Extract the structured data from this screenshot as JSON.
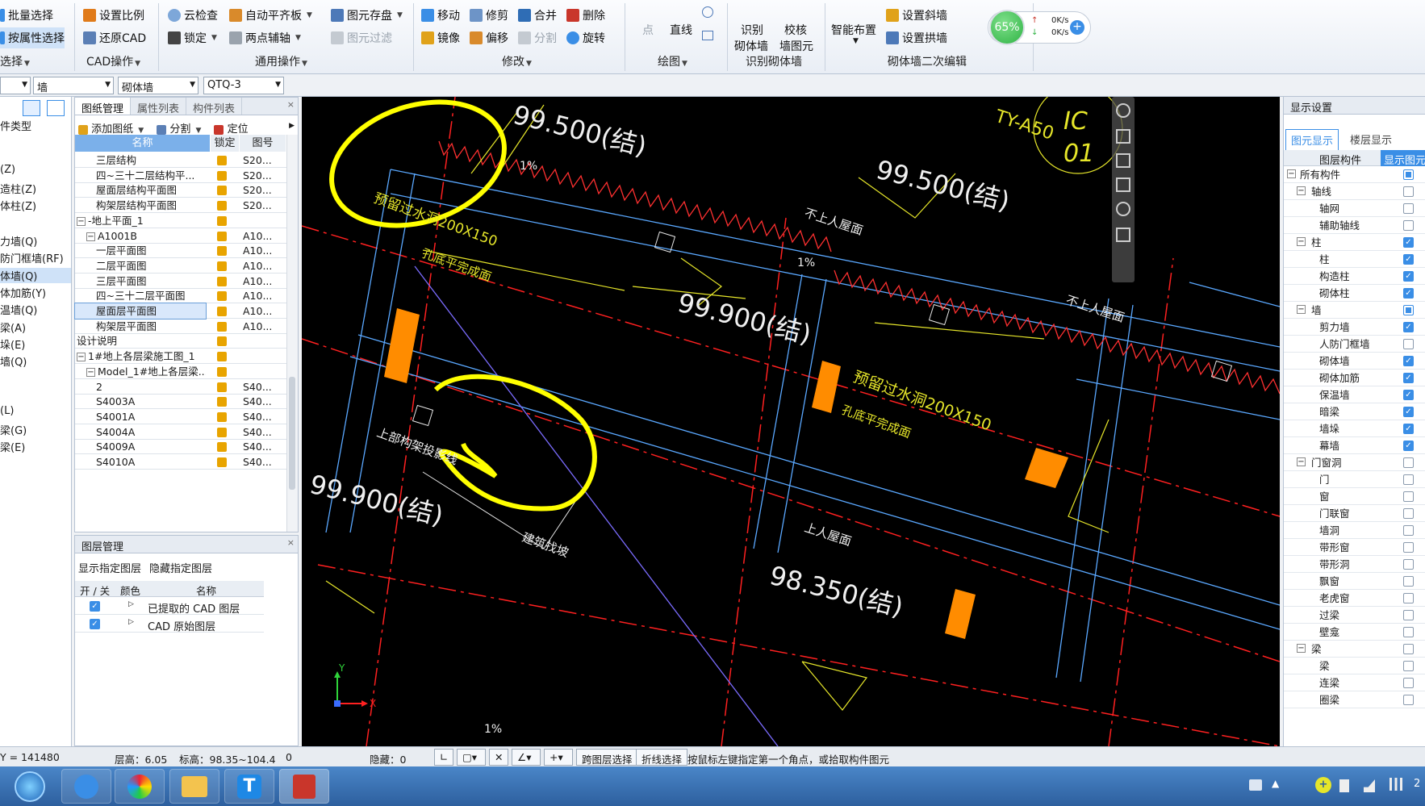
{
  "colors": {
    "accent": "#3a8ee6",
    "select_orange": "#ff8c00",
    "highlight": "#ffff00",
    "canvas_bg": "#000000",
    "green_badge": "#2fb344"
  },
  "ribbon": {
    "col0": {
      "btn1": "批量选择",
      "btn2": "按属性选择",
      "group": "选择"
    },
    "col1": {
      "btn1": "设置比例",
      "btn2": "还原CAD",
      "group": "CAD操作"
    },
    "col2": {
      "btn1": "云检查",
      "btn2": "自动平齐板",
      "btn3": "图元存盘",
      "btn4": "锁定",
      "btn5": "两点辅轴",
      "btn6": "图元过滤",
      "group": "通用操作"
    },
    "col3": {
      "btn1": "移动",
      "btn2": "修剪",
      "btn3": "合并",
      "btn4": "删除",
      "btn5": "镜像",
      "btn6": "偏移",
      "btn7": "分割",
      "btn8": "旋转",
      "group": "修改"
    },
    "col4": {
      "btn1": "点",
      "btn2": "直线",
      "group": "绘图"
    },
    "col5": {
      "btn1a": "识别",
      "btn1b": "砌体墙",
      "btn2a": "校核",
      "btn2b": "墙图元",
      "group": "识别砌体墙"
    },
    "col6": {
      "btn1": "智能布置",
      "btn2": "设置斜墙",
      "btn3": "设置拱墙",
      "group": "砌体墙二次编辑"
    },
    "net": {
      "percent": "65%",
      "up": "0K/s",
      "down": "0K/s"
    }
  },
  "toolbar2": {
    "combo1": "",
    "combo2": "墙",
    "combo3": "砌体墙",
    "combo4": "QTQ-3"
  },
  "leftcol": {
    "items": [
      "件类型",
      "(Z)",
      "造柱(Z)",
      "体柱(Z)",
      "力墙(Q)",
      "防门框墙(RF)",
      "体墙(Q)",
      "体加筋(Y)",
      "温墙(Q)",
      "梁(A)",
      "垛(E)",
      "墙(Q)",
      "(L)",
      "梁(G)",
      "梁(E)"
    ]
  },
  "drawpanel": {
    "tabs": [
      "图纸管理",
      "属性列表",
      "构件列表"
    ],
    "toolbar": {
      "add": "添加图纸",
      "split": "分割",
      "locate": "定位"
    },
    "headers": {
      "name": "名称",
      "lock": "锁定",
      "code": "图号"
    },
    "rows": [
      {
        "name": "三层结构",
        "code": "S20..."
      },
      {
        "name": "四~三十二层结构平...",
        "code": "S20..."
      },
      {
        "name": "屋面层结构平面图",
        "code": "S20..."
      },
      {
        "name": "构架层结构平面图",
        "code": "S20..."
      },
      {
        "name": "-地上平面_1",
        "code": ""
      },
      {
        "name": "A1001B",
        "code": "A10..."
      },
      {
        "name": "一层平面图",
        "code": "A10..."
      },
      {
        "name": "二层平面图",
        "code": "A10..."
      },
      {
        "name": "三层平面图",
        "code": "A10..."
      },
      {
        "name": "四~三十二层平面图",
        "code": "A10..."
      },
      {
        "name": "屋面层平面图",
        "code": "A10..."
      },
      {
        "name": "构架层平面图",
        "code": "A10..."
      },
      {
        "name": "设计说明",
        "code": ""
      },
      {
        "name": "1#地上各层梁施工图_1",
        "code": ""
      },
      {
        "name": "Model_1#地上各层梁...",
        "code": ""
      },
      {
        "name": "2",
        "code": "S40..."
      },
      {
        "name": "S4003A",
        "code": "S40..."
      },
      {
        "name": "S4001A",
        "code": "S40..."
      },
      {
        "name": "S4004A",
        "code": "S40..."
      },
      {
        "name": "S4009A",
        "code": "S40..."
      },
      {
        "name": "S4010A",
        "code": "S40..."
      }
    ]
  },
  "layerpanel": {
    "title": "图层管理",
    "show_btn": "显示指定图层",
    "hide_btn": "隐藏指定图层",
    "h_onoff": "开 / 关",
    "h_color": "颜色",
    "h_name": "名称",
    "rows": [
      "已提取的 CAD 图层",
      "CAD 原始图层"
    ]
  },
  "canvas": {
    "t1": "99.500(结)",
    "t2": "99.500(结)",
    "t3": "99.900(结)",
    "t4": "99.900(结)",
    "t5": "98.350(结)",
    "t6": "预留过水洞200X150",
    "t7": "孔底平完成面",
    "t8": "预留过水洞200X150",
    "t9": "孔底平完成面",
    "t10": "不上人屋面",
    "t11": "不上人屋面",
    "t12": "上人屋面",
    "t13": "上部构架投影线",
    "t14": "建筑找坡",
    "t15": "1%",
    "t16": "1%",
    "t17": "1%",
    "t18": "IC",
    "t19": "01",
    "t20": "TY-A50",
    "ax_x": "X",
    "ax_y": "Y"
  },
  "rightpanel": {
    "title": "显示设置",
    "tab1": "图元显示",
    "tab2": "楼层显示",
    "h1": "图层构件",
    "h2": "显示图元",
    "rows": [
      {
        "name": "所有构件",
        "lv": 0,
        "exp": true,
        "ck": "partial"
      },
      {
        "name": "轴线",
        "lv": 1,
        "exp": true,
        "ck": "off"
      },
      {
        "name": "轴网",
        "lv": 2,
        "exp": false,
        "ck": "off"
      },
      {
        "name": "辅助轴线",
        "lv": 2,
        "exp": false,
        "ck": "off"
      },
      {
        "name": "柱",
        "lv": 1,
        "exp": true,
        "ck": "on"
      },
      {
        "name": "柱",
        "lv": 2,
        "exp": false,
        "ck": "on"
      },
      {
        "name": "构造柱",
        "lv": 2,
        "exp": false,
        "ck": "on"
      },
      {
        "name": "砌体柱",
        "lv": 2,
        "exp": false,
        "ck": "on"
      },
      {
        "name": "墙",
        "lv": 1,
        "exp": true,
        "ck": "partial"
      },
      {
        "name": "剪力墙",
        "lv": 2,
        "exp": false,
        "ck": "on"
      },
      {
        "name": "人防门框墙",
        "lv": 2,
        "exp": false,
        "ck": "off"
      },
      {
        "name": "砌体墙",
        "lv": 2,
        "exp": false,
        "ck": "on"
      },
      {
        "name": "砌体加筋",
        "lv": 2,
        "exp": false,
        "ck": "on"
      },
      {
        "name": "保温墙",
        "lv": 2,
        "exp": false,
        "ck": "on"
      },
      {
        "name": "暗梁",
        "lv": 2,
        "exp": false,
        "ck": "on"
      },
      {
        "name": "墙垛",
        "lv": 2,
        "exp": false,
        "ck": "on"
      },
      {
        "name": "幕墙",
        "lv": 2,
        "exp": false,
        "ck": "on"
      },
      {
        "name": "门窗洞",
        "lv": 1,
        "exp": true,
        "ck": "off"
      },
      {
        "name": "门",
        "lv": 2,
        "exp": false,
        "ck": "off"
      },
      {
        "name": "窗",
        "lv": 2,
        "exp": false,
        "ck": "off"
      },
      {
        "name": "门联窗",
        "lv": 2,
        "exp": false,
        "ck": "off"
      },
      {
        "name": "墙洞",
        "lv": 2,
        "exp": false,
        "ck": "off"
      },
      {
        "name": "带形窗",
        "lv": 2,
        "exp": false,
        "ck": "off"
      },
      {
        "name": "带形洞",
        "lv": 2,
        "exp": false,
        "ck": "off"
      },
      {
        "name": "飘窗",
        "lv": 2,
        "exp": false,
        "ck": "off"
      },
      {
        "name": "老虎窗",
        "lv": 2,
        "exp": false,
        "ck": "off"
      },
      {
        "name": "过梁",
        "lv": 2,
        "exp": false,
        "ck": "off"
      },
      {
        "name": "壁龛",
        "lv": 2,
        "exp": false,
        "ck": "off"
      },
      {
        "name": "梁",
        "lv": 1,
        "exp": true,
        "ck": "off"
      },
      {
        "name": "梁",
        "lv": 2,
        "exp": false,
        "ck": "off"
      },
      {
        "name": "连梁",
        "lv": 2,
        "exp": false,
        "ck": "off"
      },
      {
        "name": "圈梁",
        "lv": 2,
        "exp": false,
        "ck": "off"
      }
    ]
  },
  "status": {
    "coord": "Y = 141480",
    "floor_h": "层高：6.05",
    "elev": "标高：98.35~104.4",
    "zero": "0",
    "hidden": "隐藏：0",
    "btn_cross": "跨图层选择",
    "btn_poly": "折线选择",
    "hint": "按鼠标左键指定第一个角点，或拾取构件图元"
  },
  "taskbar": {
    "time": "2"
  }
}
